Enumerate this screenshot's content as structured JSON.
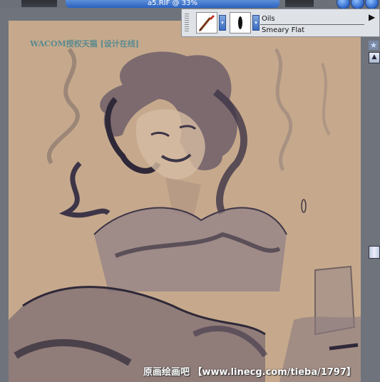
{
  "window": {
    "title": "a5.RIF @ 33%"
  },
  "watermarks": {
    "top": "WACOM授权天猫 [设计在线]",
    "bottom": "原画绘画吧 【www.linecg.com/tieba/1797】"
  },
  "brush_toolbar": {
    "category": "Oils",
    "variant": "Smeary Flat"
  },
  "icons": {
    "brush": "paintbrush-icon",
    "variant": "brush-dab-icon",
    "expand": "triangle-right-icon"
  },
  "colors": {
    "canvas": "#c6a98c",
    "sketch": "#3d3547",
    "title_bar": "#2a62c0"
  }
}
